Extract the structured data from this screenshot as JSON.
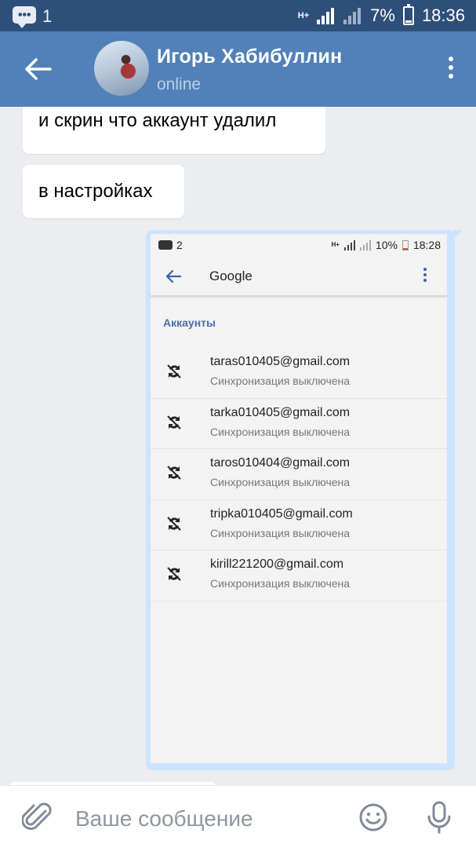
{
  "status_bar": {
    "notification_count": "1",
    "network": "H+",
    "battery": "7%",
    "time": "18:36"
  },
  "header": {
    "name": "Игорь Хабибуллин",
    "status": "online"
  },
  "messages": [
    {
      "direction": "in",
      "text": "и скрин что аккаунт удалил"
    },
    {
      "direction": "in",
      "text": "в настройках"
    }
  ],
  "attached_screenshot": {
    "status_bar": {
      "notification_count": "2",
      "network": "H+",
      "battery": "10%",
      "time": "18:28"
    },
    "title": "Google",
    "section_title": "Аккаунты",
    "accounts": [
      {
        "email": "taras010405@gmail.com",
        "status": "Синхронизация выключена"
      },
      {
        "email": "tarka010405@gmail.com",
        "status": "Синхронизация выключена"
      },
      {
        "email": "taros010404@gmail.com",
        "status": "Синхронизация выключена"
      },
      {
        "email": "tripka010405@gmail.com",
        "status": "Синхронизация выключена"
      },
      {
        "email": "kirill221200@gmail.com",
        "status": "Синхронизация выключена"
      }
    ]
  },
  "composer": {
    "placeholder": "Ваше сообщение"
  },
  "colors": {
    "header": "#5181b8",
    "status_bar": "#2e4f7a",
    "outgoing_bubble": "#cce4ff",
    "chat_background": "#ebedf0"
  },
  "icons": [
    "back-arrow-icon",
    "kebab-menu-icon",
    "sync-off-icon",
    "paperclip-icon",
    "smile-icon",
    "microphone-icon"
  ]
}
